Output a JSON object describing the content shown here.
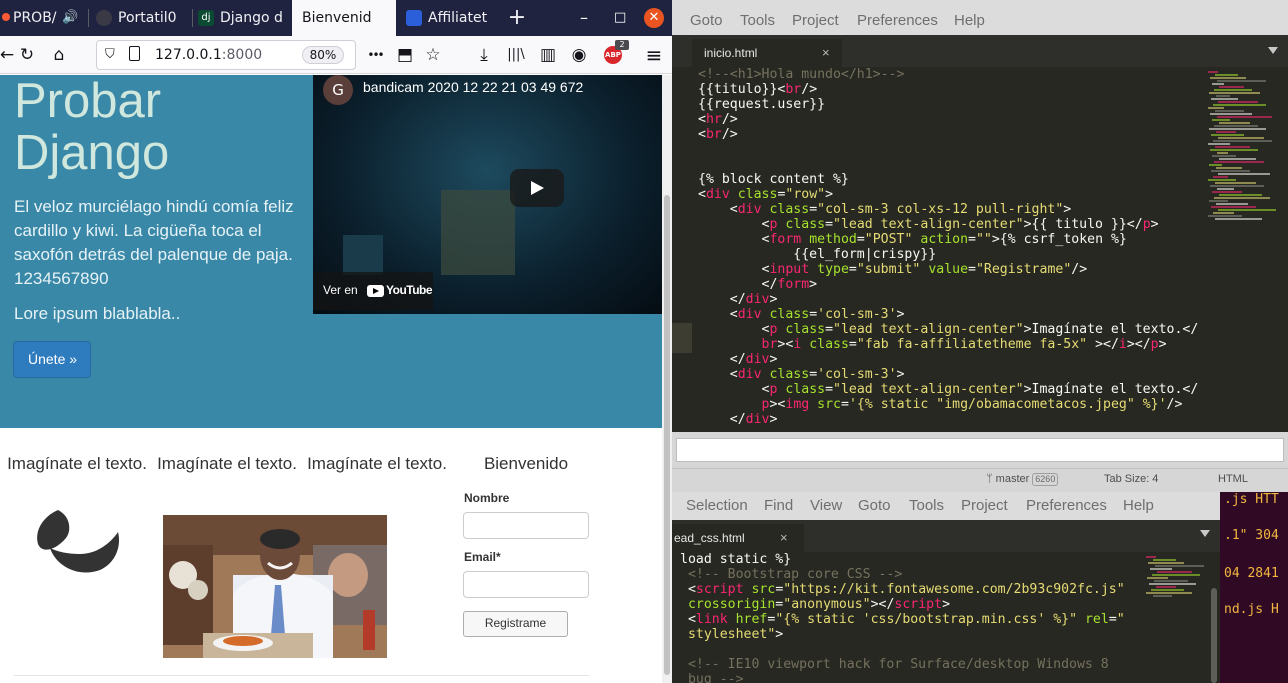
{
  "firefox": {
    "tabs": [
      {
        "label": "PROB/",
        "icon": "firefox-icon"
      },
      {
        "label": "Portatil0",
        "icon": "github-icon"
      },
      {
        "label": "Django d",
        "icon": "django-icon"
      },
      {
        "label": "Bienvenid",
        "icon": "",
        "active": true
      },
      {
        "label": "Affiliatet",
        "icon": "flag-icon"
      }
    ],
    "new_tab": "+",
    "window_controls": {
      "minimize": "–",
      "maximize": "□",
      "close": "✕"
    },
    "nav": {
      "back": "←",
      "reload": "↻",
      "home": "⌂",
      "url_host": "127.0.0.1",
      "url_port": ":8000",
      "zoom": "80%",
      "more": "•••",
      "pocket": "⬒",
      "bookmark": "☆",
      "download": "⤓",
      "library": "|||\\",
      "sidebar": "▥",
      "account": "◉",
      "abp_label": "ABP",
      "abp_count": "2",
      "menu": "≡"
    },
    "page": {
      "jumbotron": {
        "title": "Probar Django",
        "text": "El veloz murciélago hindú comía feliz cardillo y kiwi. La cigüeña toca el saxofón detrás del palenque de paja. 1234567890",
        "lorem": "Lore ipsum blablabla..",
        "join_button": "Únete »"
      },
      "video": {
        "channel_initial": "G",
        "title": "bandicam 2020 12 22 21 03 49 672",
        "watch_on": "Ver en",
        "brand": "YouTube"
      },
      "columns": [
        {
          "heading": "Imagínate el texto."
        },
        {
          "heading": "Imagínate el texto."
        },
        {
          "heading": "Imagínate el texto."
        },
        {
          "heading": "Bienvenido"
        }
      ],
      "form": {
        "name_label": "Nombre",
        "email_label": "Email*",
        "submit": "Registrame"
      }
    }
  },
  "sublime_top": {
    "menu": [
      "Goto",
      "Tools",
      "Project",
      "Preferences",
      "Help"
    ],
    "tab": {
      "label": "inicio.html",
      "close": "×"
    },
    "code_lines": [
      [
        [
          "c-cm",
          "<!--<h1>Hola mundo</h1>-->"
        ]
      ],
      [
        [
          "c-sym",
          "{{titulo}}"
        ],
        [
          "c-sym",
          "<"
        ],
        [
          "c-tag",
          "br"
        ],
        [
          "c-sym",
          "/>"
        ]
      ],
      [
        [
          "c-sym",
          "{{request.user}}"
        ]
      ],
      [
        [
          "c-sym",
          "<"
        ],
        [
          "c-tag",
          "hr"
        ],
        [
          "c-sym",
          "/>"
        ]
      ],
      [
        [
          "c-sym",
          "<"
        ],
        [
          "c-tag",
          "br"
        ],
        [
          "c-sym",
          "/>"
        ]
      ],
      [
        [
          "c-sym",
          ""
        ]
      ],
      [
        [
          "c-sym",
          ""
        ]
      ],
      [
        [
          "c-sym",
          "{% block content %}"
        ]
      ],
      [
        [
          "c-sym",
          "<"
        ],
        [
          "c-tag",
          "div"
        ],
        [
          "c-sym",
          " "
        ],
        [
          "c-att",
          "class"
        ],
        [
          "c-sym",
          "="
        ],
        [
          "c-str",
          "\"row\""
        ],
        [
          "c-sym",
          ">"
        ]
      ],
      [
        [
          "c-sym",
          "    <"
        ],
        [
          "c-tag",
          "div"
        ],
        [
          "c-sym",
          " "
        ],
        [
          "c-att",
          "class"
        ],
        [
          "c-sym",
          "="
        ],
        [
          "c-str",
          "\"col-sm-3 col-xs-12 pull-right\""
        ],
        [
          "c-sym",
          ">"
        ]
      ],
      [
        [
          "c-sym",
          "        <"
        ],
        [
          "c-tag",
          "p"
        ],
        [
          "c-sym",
          " "
        ],
        [
          "c-att",
          "class"
        ],
        [
          "c-sym",
          "="
        ],
        [
          "c-str",
          "\"lead text-align-center\""
        ],
        [
          "c-sym",
          ">{{ titulo }}</"
        ],
        [
          "c-tag",
          "p"
        ],
        [
          "c-sym",
          ">"
        ]
      ],
      [
        [
          "c-sym",
          "        <"
        ],
        [
          "c-tag",
          "form"
        ],
        [
          "c-sym",
          " "
        ],
        [
          "c-att",
          "method"
        ],
        [
          "c-sym",
          "="
        ],
        [
          "c-str",
          "\"POST\""
        ],
        [
          "c-sym",
          " "
        ],
        [
          "c-att",
          "action"
        ],
        [
          "c-sym",
          "="
        ],
        [
          "c-str",
          "\"\""
        ],
        [
          "c-sym",
          ">{% csrf_token %}"
        ]
      ],
      [
        [
          "c-sym",
          "            {{el_form|crispy}}"
        ]
      ],
      [
        [
          "c-sym",
          "        <"
        ],
        [
          "c-tag",
          "input"
        ],
        [
          "c-sym",
          " "
        ],
        [
          "c-att",
          "type"
        ],
        [
          "c-sym",
          "="
        ],
        [
          "c-str",
          "\"submit\""
        ],
        [
          "c-sym",
          " "
        ],
        [
          "c-att",
          "value"
        ],
        [
          "c-sym",
          "="
        ],
        [
          "c-str",
          "\"Registrame\""
        ],
        [
          "c-sym",
          "/>"
        ]
      ],
      [
        [
          "c-sym",
          "        </"
        ],
        [
          "c-tag",
          "form"
        ],
        [
          "c-sym",
          ">"
        ]
      ],
      [
        [
          "c-sym",
          "    </"
        ],
        [
          "c-tag",
          "div"
        ],
        [
          "c-sym",
          ">"
        ]
      ],
      [
        [
          "c-sym",
          "    <"
        ],
        [
          "c-tag",
          "div"
        ],
        [
          "c-sym",
          " "
        ],
        [
          "c-att",
          "class"
        ],
        [
          "c-sym",
          "="
        ],
        [
          "c-str",
          "'col-sm-3'"
        ],
        [
          "c-sym",
          ">"
        ]
      ],
      [
        [
          "c-sym",
          "        <"
        ],
        [
          "c-tag",
          "p"
        ],
        [
          "c-sym",
          " "
        ],
        [
          "c-att",
          "class"
        ],
        [
          "c-sym",
          "="
        ],
        [
          "c-str",
          "\"lead text-align-center\""
        ],
        [
          "c-sym",
          ">Imagínate el texto.</"
        ]
      ],
      [
        [
          "c-sym",
          "        "
        ],
        [
          "c-tag",
          "br"
        ],
        [
          "c-sym",
          "><"
        ],
        [
          "c-tag",
          "i"
        ],
        [
          "c-sym",
          " "
        ],
        [
          "c-att",
          "class"
        ],
        [
          "c-sym",
          "="
        ],
        [
          "c-str",
          "\"fab fa-affiliatetheme fa-5x\""
        ],
        [
          "c-sym",
          " ></"
        ],
        [
          "c-tag",
          "i"
        ],
        [
          "c-sym",
          "></"
        ],
        [
          "c-tag",
          "p"
        ],
        [
          "c-sym",
          ">"
        ]
      ],
      [
        [
          "c-sym",
          "    </"
        ],
        [
          "c-tag",
          "div"
        ],
        [
          "c-sym",
          ">"
        ]
      ],
      [
        [
          "c-sym",
          "    <"
        ],
        [
          "c-tag",
          "div"
        ],
        [
          "c-sym",
          " "
        ],
        [
          "c-att",
          "class"
        ],
        [
          "c-sym",
          "="
        ],
        [
          "c-str",
          "'col-sm-3'"
        ],
        [
          "c-sym",
          ">"
        ]
      ],
      [
        [
          "c-sym",
          "        <"
        ],
        [
          "c-tag",
          "p"
        ],
        [
          "c-sym",
          " "
        ],
        [
          "c-att",
          "class"
        ],
        [
          "c-sym",
          "="
        ],
        [
          "c-str",
          "\"lead text-align-center\""
        ],
        [
          "c-sym",
          ">Imagínate el texto.</"
        ]
      ],
      [
        [
          "c-sym",
          "        "
        ],
        [
          "c-tag",
          "p"
        ],
        [
          "c-sym",
          "><"
        ],
        [
          "c-tag",
          "img"
        ],
        [
          "c-sym",
          " "
        ],
        [
          "c-att",
          "src"
        ],
        [
          "c-sym",
          "="
        ],
        [
          "c-str",
          "'{% static \"img/obamacometacos.jpeg\" %}'"
        ],
        [
          "c-sym",
          "/>"
        ]
      ],
      [
        [
          "c-sym",
          "    </"
        ],
        [
          "c-tag",
          "div"
        ],
        [
          "c-sym",
          ">"
        ]
      ]
    ],
    "status": {
      "branch": "master",
      "branch_count": "6260",
      "tab_size": "Tab Size: 4",
      "syntax": "HTML"
    }
  },
  "sublime_bottom": {
    "menu": [
      "Selection",
      "Find",
      "View",
      "Goto",
      "Tools",
      "Project",
      "Preferences",
      "Help"
    ],
    "tab": {
      "label": "ead_css.html",
      "close": "×"
    },
    "code_lines": [
      [
        [
          "c-sym",
          "load static %}"
        ]
      ],
      [
        [
          "c-cm",
          " <!-- Bootstrap core CSS -->"
        ]
      ],
      [
        [
          "c-sym",
          " <"
        ],
        [
          "c-tag",
          "script"
        ],
        [
          "c-sym",
          " "
        ],
        [
          "c-att",
          "src"
        ],
        [
          "c-sym",
          "="
        ],
        [
          "c-str",
          "\"https://kit.fontawesome.com/2b93c902fc.js\""
        ]
      ],
      [
        [
          "c-sym",
          " "
        ],
        [
          "c-att",
          "crossorigin"
        ],
        [
          "c-sym",
          "="
        ],
        [
          "c-str",
          "\"anonymous\""
        ],
        [
          "c-sym",
          "></"
        ],
        [
          "c-tag",
          "script"
        ],
        [
          "c-sym",
          ">"
        ]
      ],
      [
        [
          "c-sym",
          " <"
        ],
        [
          "c-tag",
          "link"
        ],
        [
          "c-sym",
          " "
        ],
        [
          "c-att",
          "href"
        ],
        [
          "c-sym",
          "="
        ],
        [
          "c-str",
          "\"{% static 'css/bootstrap.min.css' %}\""
        ],
        [
          "c-sym",
          " "
        ],
        [
          "c-att",
          "rel"
        ],
        [
          "c-sym",
          "="
        ],
        [
          "c-str",
          "\""
        ]
      ],
      [
        [
          "c-str",
          " stylesheet\""
        ],
        [
          "c-sym",
          ">"
        ]
      ],
      [
        [
          "c-sym",
          ""
        ]
      ],
      [
        [
          "c-cm",
          " <!-- IE10 viewport hack for Surface/desktop Windows 8"
        ]
      ],
      [
        [
          "c-cm",
          " bug -->"
        ]
      ]
    ]
  },
  "terminal": {
    "lines": [
      ".js HTT",
      ".1\" 304",
      "04 2841",
      "nd.js H"
    ]
  },
  "colors": {
    "jumbotron_bg": "#3a88a8",
    "primary_button": "#2e7bbd",
    "sublime_bg": "#272822",
    "terminal_bg": "#300a24",
    "ubuntu_close": "#e95420"
  }
}
